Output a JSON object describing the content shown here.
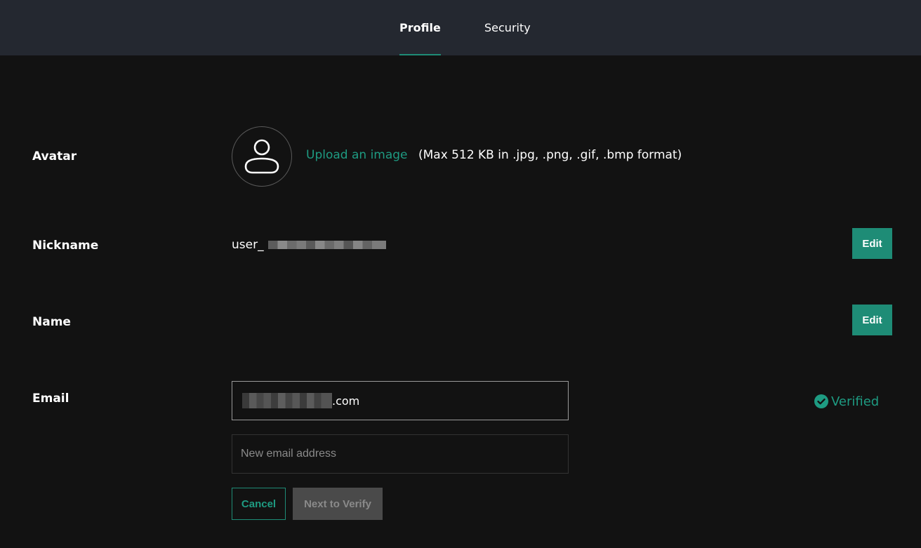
{
  "tabs": [
    {
      "label": "Profile",
      "active": true
    },
    {
      "label": "Security",
      "active": false
    }
  ],
  "avatar": {
    "label": "Avatar",
    "icon": "user-icon",
    "upload_link": "Upload an image",
    "hint": "(Max 512 KB in .jpg, .png, .gif, .bmp format)"
  },
  "nickname": {
    "label": "Nickname",
    "value_prefix": "user_",
    "edit_label": "Edit"
  },
  "name": {
    "label": "Name",
    "edit_label": "Edit"
  },
  "email": {
    "label": "Email",
    "value_suffix": ".com",
    "new_placeholder": "New email address",
    "verified_label": "Verified",
    "verified_icon": "check-circle-icon",
    "cancel_label": "Cancel",
    "next_label": "Next to Verify"
  },
  "colors": {
    "accent": "#1e8c76",
    "header_bg": "#242830",
    "page_bg": "#121212"
  }
}
